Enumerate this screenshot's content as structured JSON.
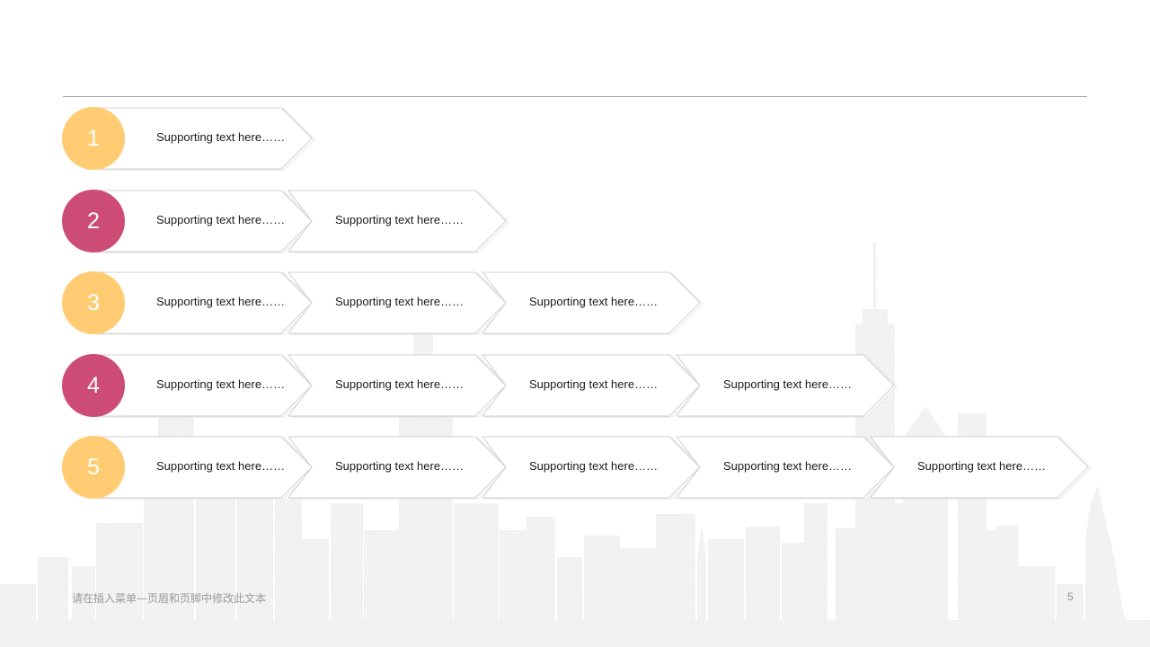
{
  "colors": {
    "yellow": "#ffcc73",
    "pink": "#cc4c76",
    "chevron_stroke": "#d0d0d0",
    "skyline": "#f2f2f2",
    "rule": "#a6a6a6"
  },
  "steps": [
    {
      "number": "1",
      "color": "yellow",
      "items": [
        "Supporting  text here……"
      ]
    },
    {
      "number": "2",
      "color": "pink",
      "items": [
        "Supporting  text here……",
        "Supporting  text here……"
      ]
    },
    {
      "number": "3",
      "color": "yellow",
      "items": [
        "Supporting  text here……",
        "Supporting  text here……",
        "Supporting  text here……"
      ]
    },
    {
      "number": "4",
      "color": "pink",
      "items": [
        "Supporting  text here……",
        "Supporting  text here……",
        "Supporting  text here……",
        "Supporting  text here……"
      ]
    },
    {
      "number": "5",
      "color": "yellow",
      "items": [
        "Supporting  text here……",
        "Supporting  text here……",
        "Supporting  text here……",
        "Supporting  text here……",
        "Supporting  text here……"
      ]
    }
  ],
  "footer": {
    "text": "请在插入菜单—页眉和页脚中修改此文本",
    "page_number": "5"
  }
}
